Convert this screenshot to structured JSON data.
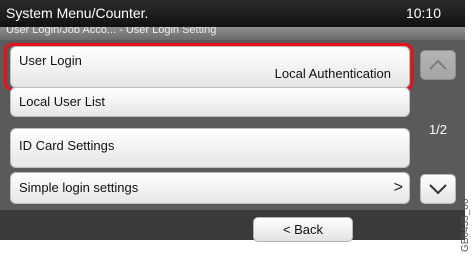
{
  "header": {
    "title": "System Menu/Counter.",
    "time": "10:10"
  },
  "breadcrumb": "User Login/Job Acco... - User Login Setting",
  "items": [
    {
      "label": "User Login",
      "value": "Local Authentication"
    },
    {
      "label": "Local User List"
    },
    {
      "label": "ID Card Settings"
    },
    {
      "label": "Simple login settings",
      "arrow": ">"
    }
  ],
  "pager": {
    "page": "1/2"
  },
  "footer": {
    "back_label": "< Back"
  },
  "watermark": "GB0435_00",
  "colors": {
    "highlight": "#e8101a",
    "header_bg": "#111111"
  }
}
